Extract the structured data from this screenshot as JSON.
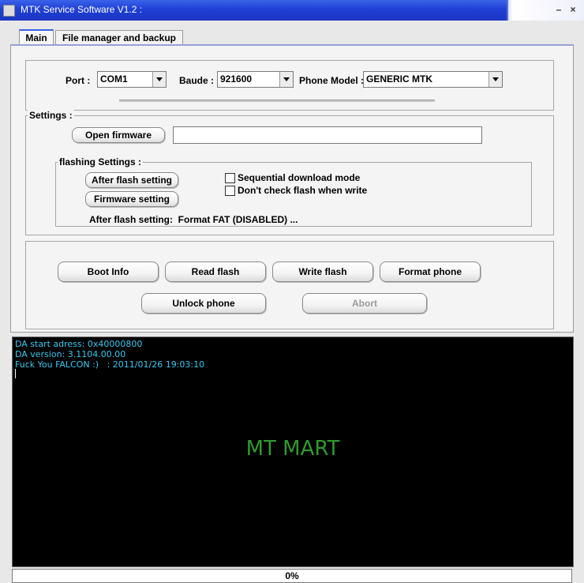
{
  "window": {
    "title": "MTK Service Software V1.2 :",
    "close_label": "×"
  },
  "tabs": [
    {
      "label": "Main",
      "active": true
    },
    {
      "label": "File manager and backup",
      "active": false
    }
  ],
  "connection": {
    "port_label": "Port :",
    "port_value": "COM1",
    "baud_label": "Baude :",
    "baud_value": "921600",
    "model_label": "Phone Model :",
    "model_value": "GENERIC MTK"
  },
  "settings": {
    "group_label": "Settings :",
    "open_firmware_button": "Open firmware",
    "firmware_path": "",
    "flashing": {
      "group_label": "flashing Settings :",
      "after_flash_button": "After flash setting",
      "firmware_setting_button": "Firmware setting",
      "sequential_label": "Sequential download mode",
      "sequential_checked": false,
      "dont_check_label": "Don't check flash when write",
      "dont_check_checked": false,
      "status_text": "After flash setting:  Format FAT (DISABLED) ..."
    }
  },
  "actions": {
    "boot_info": "Boot Info",
    "read_flash": "Read flash",
    "write_flash": "Write flash",
    "format_phone": "Format phone",
    "unlock_phone": "Unlock phone",
    "abort": "Abort"
  },
  "console": {
    "lines": [
      "DA start adress: 0x40000800",
      "DA version: 3.1104.00.00",
      "Fuck You FALCON :)   : 2011/01/26 19:03:10"
    ],
    "watermark": "MT MART"
  },
  "progress": {
    "label": "0%",
    "value": 0
  },
  "colors": {
    "titlebar": "#1f3fd6",
    "console_text": "#39c8f0",
    "watermark": "#2f9a2f"
  }
}
